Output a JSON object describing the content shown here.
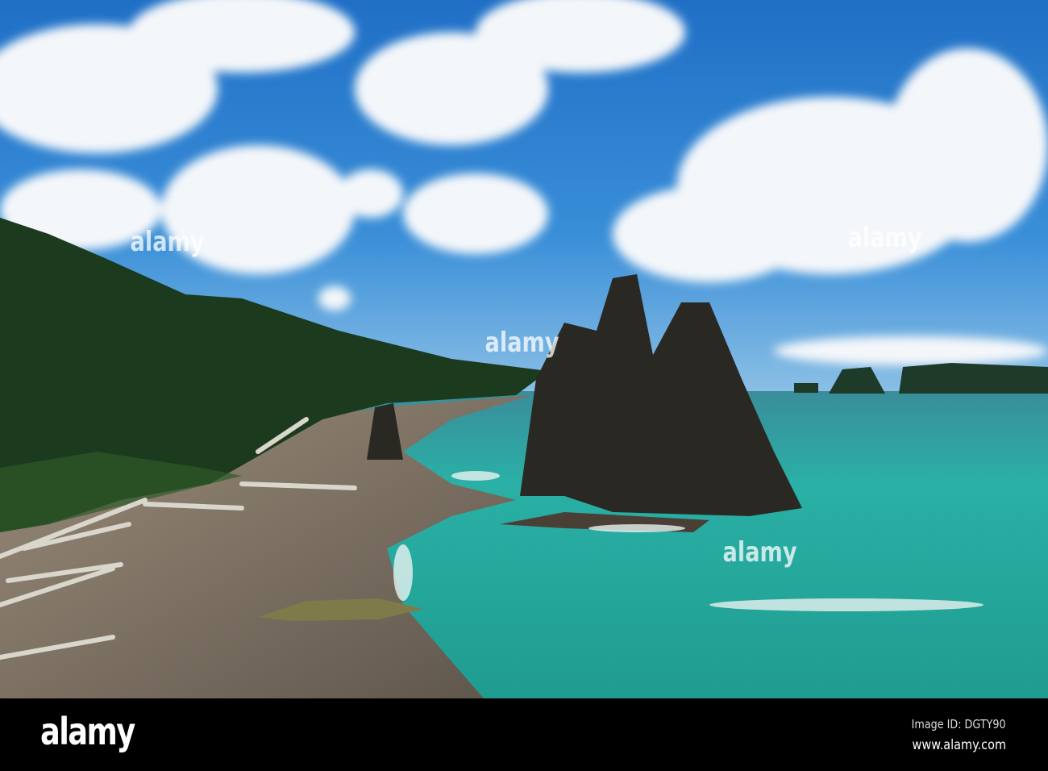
{
  "photo": {
    "watermark": "alamy",
    "colors": {
      "sky": "#2a7fd0",
      "ocean": "#2bb3a5",
      "forest": "#1d3a1e",
      "sand": "#8a7d6e",
      "rock": "#2c2a24"
    }
  },
  "footer": {
    "logo": "alamy",
    "image_id": "Image ID: DGTY90",
    "url": "www.alamy.com"
  }
}
